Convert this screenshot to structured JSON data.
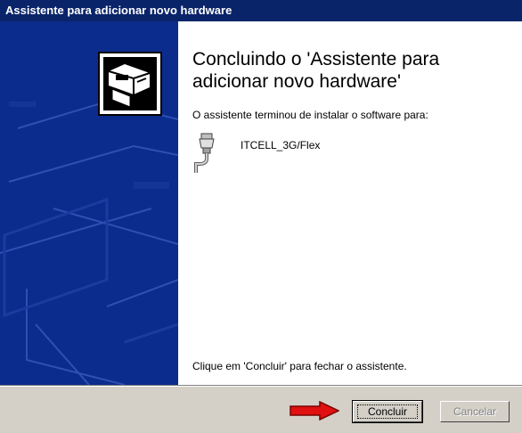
{
  "window": {
    "title": "Assistente para adicionar novo hardware"
  },
  "main": {
    "heading": "Concluindo o 'Assistente para adicionar novo hardware'",
    "subtext": "O assistente terminou de instalar o software para:",
    "device_name": "ITCELL_3G/Flex",
    "finish_text": "Clique em 'Concluir' para fechar o assistente."
  },
  "buttons": {
    "finish_label": "Concluir",
    "cancel_label": "Cancelar",
    "cancel_enabled": false
  },
  "icons": {
    "wizard": "hardware-wizard-icon",
    "device": "serial-port-icon",
    "annotation": "red-arrow-icon"
  },
  "colors": {
    "titlebar": "#0a246a",
    "sidepanel": "#0b2c8c",
    "dialog_bg": "#d4d0c8",
    "arrow": "#e01010"
  }
}
